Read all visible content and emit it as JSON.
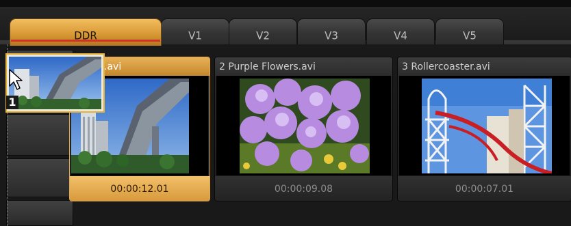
{
  "tabs": [
    {
      "label": "DDR",
      "active": true
    },
    {
      "label": "V1",
      "active": false
    },
    {
      "label": "V2",
      "active": false
    },
    {
      "label": "V3",
      "active": false
    },
    {
      "label": "V4",
      "active": false
    },
    {
      "label": "V5",
      "active": false
    }
  ],
  "clips": [
    {
      "title": "1 Skyline.avi",
      "title_visible": ".avi",
      "duration": "00:00:12.01",
      "selected": true,
      "thumbnail_icon": "monorail-skyline-thumbnail"
    },
    {
      "title": "2 Purple Flowers.avi",
      "duration": "00:00:09.08",
      "selected": false,
      "thumbnail_icon": "purple-flowers-thumbnail"
    },
    {
      "title": "3 Rollercoaster.avi",
      "duration": "00:00:07.01",
      "selected": false,
      "thumbnail_icon": "rollercoaster-thumbnail"
    }
  ],
  "drag": {
    "count": "1",
    "cursor_icon": "arrow-cursor-icon"
  },
  "colors": {
    "accent": "#d99a36",
    "active_underline": "#d23328",
    "background": "#1c1c1c"
  }
}
